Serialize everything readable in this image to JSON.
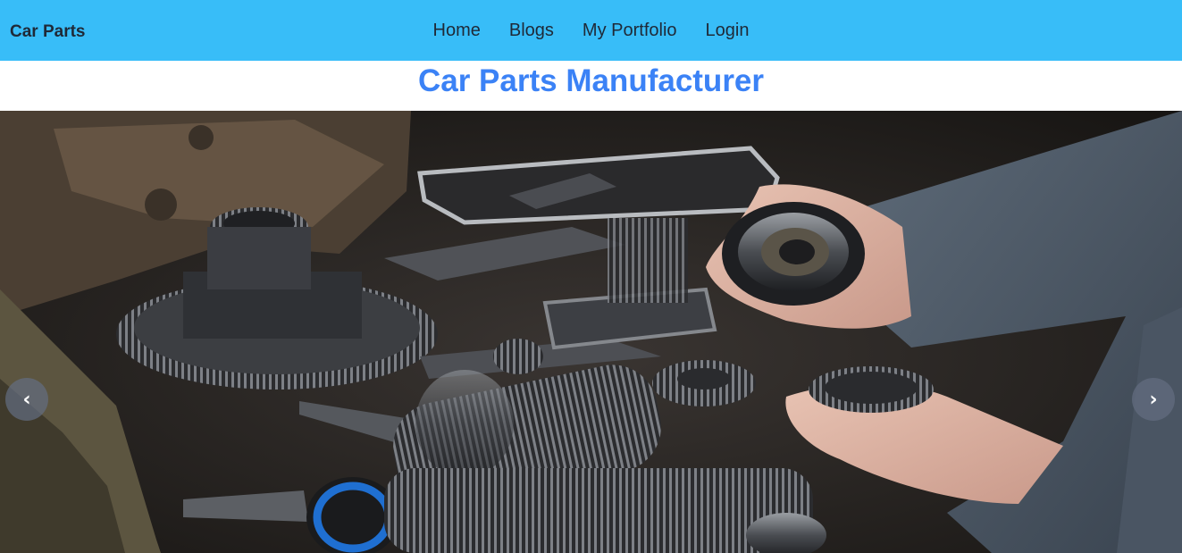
{
  "navbar": {
    "brand": "Car Parts",
    "items": [
      {
        "label": "Home"
      },
      {
        "label": "Blogs"
      },
      {
        "label": "My Portfolio"
      },
      {
        "label": "Login"
      }
    ],
    "background": "#38bdf8"
  },
  "hero": {
    "title": "Car Parts Manufacturer",
    "title_color": "#3b82f6"
  },
  "carousel": {
    "image_subject": "hands holding gear parts on a workbench",
    "prev_icon": "chevron-left-icon",
    "next_icon": "chevron-right-icon",
    "prev_glyph": "‹",
    "next_glyph": "›"
  }
}
